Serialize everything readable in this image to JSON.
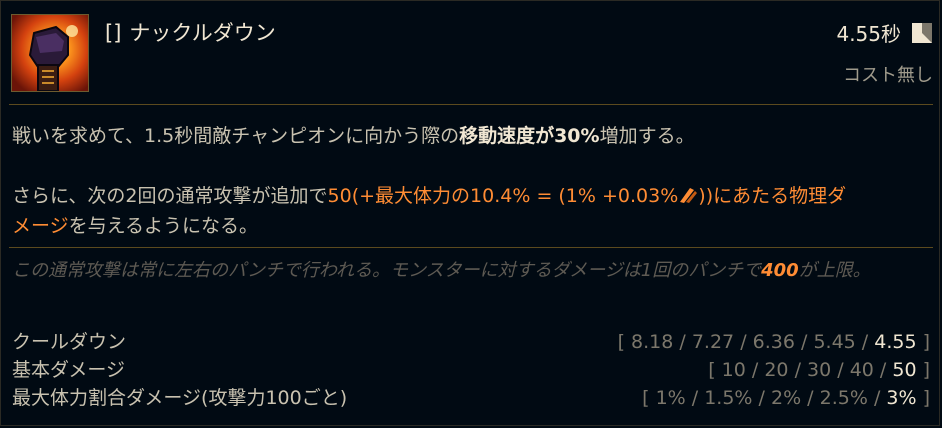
{
  "ability": {
    "hotkey": "[]",
    "name": "ナックルダウン",
    "icon": "knuckle-down-ability-icon",
    "cooldown": "4.55秒",
    "cooldown_icon": "cooldown-icon",
    "cost": "コスト無し"
  },
  "description": {
    "line1_pre": "戦いを求めて、1.5秒間敵チャンピオンに向かう際の",
    "line1_hl": "移動速度が30%",
    "line1_post": "増加する。",
    "line2_pre": "さらに、次の2回の通常攻撃が追加で",
    "line2_hl_a": "50(+最大体力の10.4% = (1% +0.03%",
    "line2_bonus_icon": "bonus-ad-icon",
    "line2_hl_b": "))にあたる物理ダ",
    "line3_hl": "メージ",
    "line3_post": "を与えるようになる。"
  },
  "note": {
    "text_pre": "この通常攻撃は常に左右のパンチで行われる。モンスターに対するダメージは1回のパンチで",
    "value": "400",
    "text_post": "が上限。"
  },
  "stats": [
    {
      "label": "クールダウン",
      "values": [
        "8.18",
        "7.27",
        "6.36",
        "5.45"
      ],
      "current": "4.55"
    },
    {
      "label": "基本ダメージ",
      "values": [
        "10",
        "20",
        "30",
        "40"
      ],
      "current": "50"
    },
    {
      "label": "最大体力割合ダメージ(攻撃力100ごと)",
      "values": [
        "1%",
        "1.5%",
        "2%",
        "2.5%"
      ],
      "current": "3%"
    }
  ],
  "colors": {
    "background": "#010a13",
    "gold_divider": "#5b4a1e",
    "highlight_orange": "#ff8c34",
    "text_light": "#f0e6d2"
  }
}
